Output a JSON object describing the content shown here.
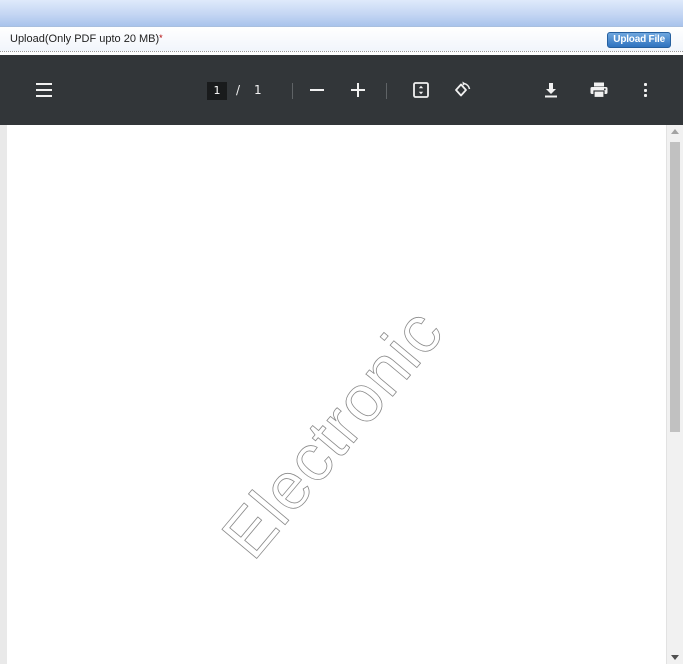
{
  "upload": {
    "label": "Upload(Only PDF upto 20 MB)",
    "required_mark": "*",
    "button_label": "Upload File"
  },
  "pdf_viewer": {
    "current_page": "1",
    "page_separator": "/",
    "total_pages": "1",
    "toolbar_icons": [
      "menu-icon",
      "zoom-out-icon",
      "zoom-in-icon",
      "fit-page-icon",
      "rotate-icon",
      "download-icon",
      "print-icon",
      "more-options-icon"
    ],
    "watermark_text": "Electronic"
  },
  "colors": {
    "toolbar_bg": "#323639",
    "upload_button": "#2f73bf",
    "header_strip": "#c4d6f3"
  }
}
